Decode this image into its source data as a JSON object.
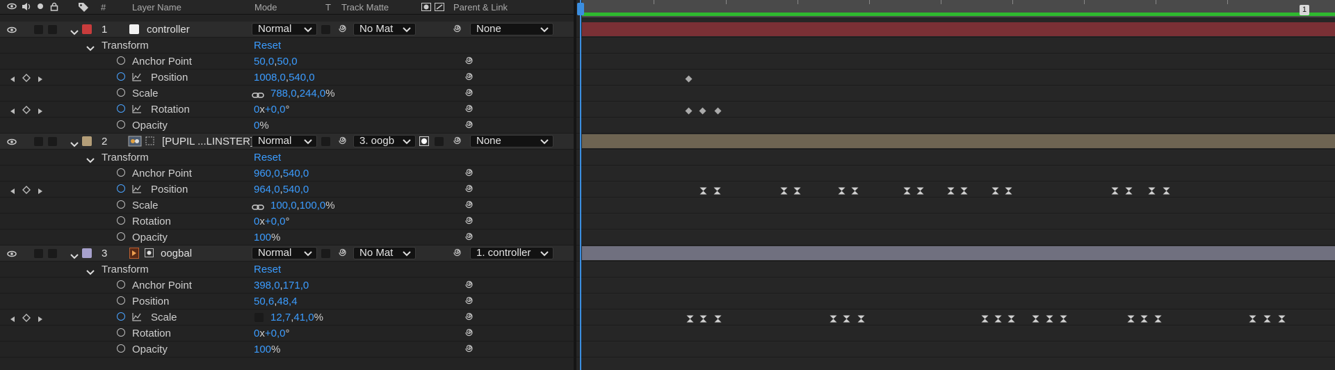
{
  "header": {
    "col_num": "#",
    "col_layer_name": "Layer Name",
    "col_mode": "Mode",
    "col_t": "T",
    "col_track_matte": "Track Matte",
    "col_parent": "Parent & Link"
  },
  "colors": {
    "accent_blue": "#3b9cff",
    "layer1_label": "#c83c3c",
    "layer2_label": "#b49e78",
    "layer3_label": "#a6a0cc",
    "layer1_bar": "#7a3035",
    "layer2_bar": "#6e6452",
    "layer3_bar": "#70707f",
    "work_area": "#2fb82f"
  },
  "timeline": {
    "marker_label": "1"
  },
  "layers": [
    {
      "num": "1",
      "name": "controller",
      "mode": "Normal",
      "matte": "No Mat",
      "parent": "None",
      "transform_label": "Transform",
      "reset": "Reset",
      "props": {
        "anchor": {
          "label": "Anchor Point",
          "v1": "50,0",
          "sep": ",",
          "v2": "50,0"
        },
        "position": {
          "label": "Position",
          "v1": "1008,0",
          "sep": ",",
          "v2": "540,0"
        },
        "scale": {
          "label": "Scale",
          "v1": "788,0",
          "sep": ",",
          "v2": "244,0",
          "unit": "%"
        },
        "rotation": {
          "label": "Rotation",
          "v1": "0",
          "x": "x",
          "v2": "+0,0",
          "unit": "°"
        },
        "opacity": {
          "label": "Opacity",
          "v1": "0",
          "unit": "%"
        }
      }
    },
    {
      "num": "2",
      "name": "[PUPIL ...LINSTER]",
      "mode": "Normal",
      "matte": "3. oogb",
      "parent": "None",
      "transform_label": "Transform",
      "reset": "Reset",
      "props": {
        "anchor": {
          "label": "Anchor Point",
          "v1": "960,0",
          "sep": ",",
          "v2": "540,0"
        },
        "position": {
          "label": "Position",
          "v1": "964,0",
          "sep": ",",
          "v2": "540,0"
        },
        "scale": {
          "label": "Scale",
          "v1": "100,0",
          "sep": ",",
          "v2": "100,0",
          "unit": "%"
        },
        "rotation": {
          "label": "Rotation",
          "v1": "0",
          "x": "x",
          "v2": "+0,0",
          "unit": "°"
        },
        "opacity": {
          "label": "Opacity",
          "v1": "100",
          "unit": "%"
        }
      }
    },
    {
      "num": "3",
      "name": "oogbal",
      "mode": "Normal",
      "matte": "No Mat",
      "parent": "1. controller",
      "transform_label": "Transform",
      "reset": "Reset",
      "props": {
        "anchor": {
          "label": "Anchor Point",
          "v1": "398,0",
          "sep": ",",
          "v2": "171,0"
        },
        "position": {
          "label": "Position",
          "v1": "50,6",
          "sep": ",",
          "v2": "48,4"
        },
        "scale": {
          "label": "Scale",
          "v1": "12,7",
          "sep": ",",
          "v2": "41,0",
          "unit": "%"
        },
        "rotation": {
          "label": "Rotation",
          "v1": "0",
          "x": "x",
          "v2": "+0,0",
          "unit": "°"
        },
        "opacity": {
          "label": "Opacity",
          "v1": "100",
          "unit": "%"
        }
      }
    }
  ]
}
